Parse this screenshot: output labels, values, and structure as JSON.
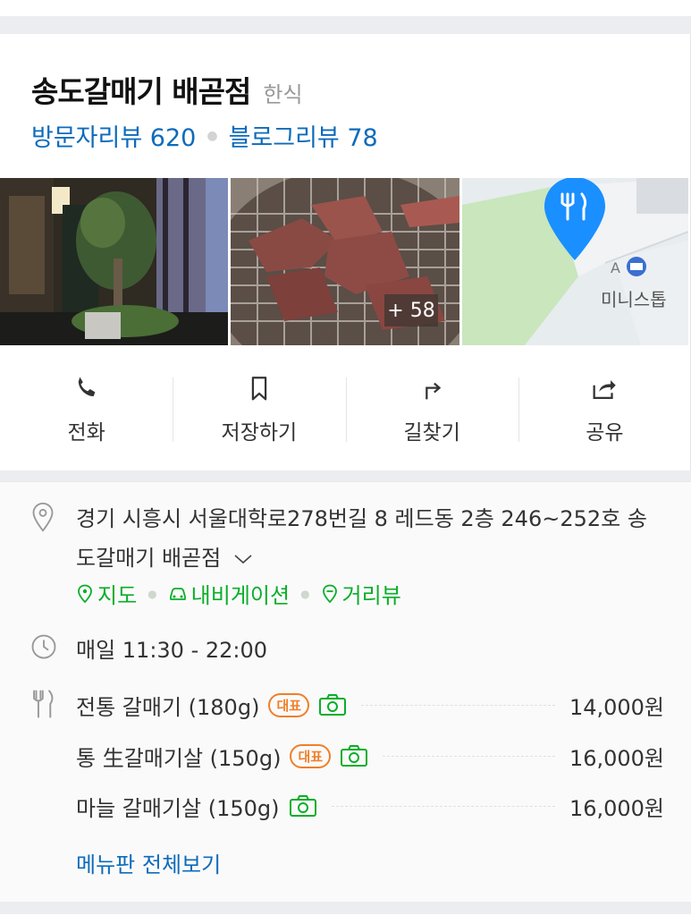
{
  "place": {
    "name": "송도갈매기 배곧점",
    "category": "한식"
  },
  "reviews": {
    "visitor_label": "방문자리뷰",
    "visitor_count": "620",
    "blog_label": "블로그리뷰",
    "blog_count": "78"
  },
  "photos": {
    "more_count": "+ 58"
  },
  "map_preview": {
    "poi_label": "미니스톱",
    "marker_letter": "A"
  },
  "actions": [
    {
      "label": "전화",
      "icon": "phone-icon"
    },
    {
      "label": "저장하기",
      "icon": "bookmark-icon"
    },
    {
      "label": "길찾기",
      "icon": "directions-icon"
    },
    {
      "label": "공유",
      "icon": "share-icon"
    }
  ],
  "address": {
    "text": "경기 시흥시 서울대학로278번길 8 레드동 2층 246~252호 송도갈매기 배곧점",
    "links": [
      "지도",
      "내비게이션",
      "거리뷰"
    ]
  },
  "hours": {
    "text": "매일 11:30 - 22:00"
  },
  "menu": {
    "items": [
      {
        "name": "전통 갈매기 (180g)",
        "badge": "대표",
        "price": "14,000원"
      },
      {
        "name": "통 生갈매기살 (150g)",
        "badge": "대표",
        "price": "16,000원"
      },
      {
        "name": "마늘 갈매기살 (150g)",
        "badge": "",
        "price": "16,000원"
      }
    ],
    "view_all": "메뉴판 전체보기"
  },
  "colors": {
    "link_blue": "#0d6bbb",
    "green": "#0aae2b",
    "badge_orange": "#f07f28",
    "map_pin": "#1a8fff"
  }
}
